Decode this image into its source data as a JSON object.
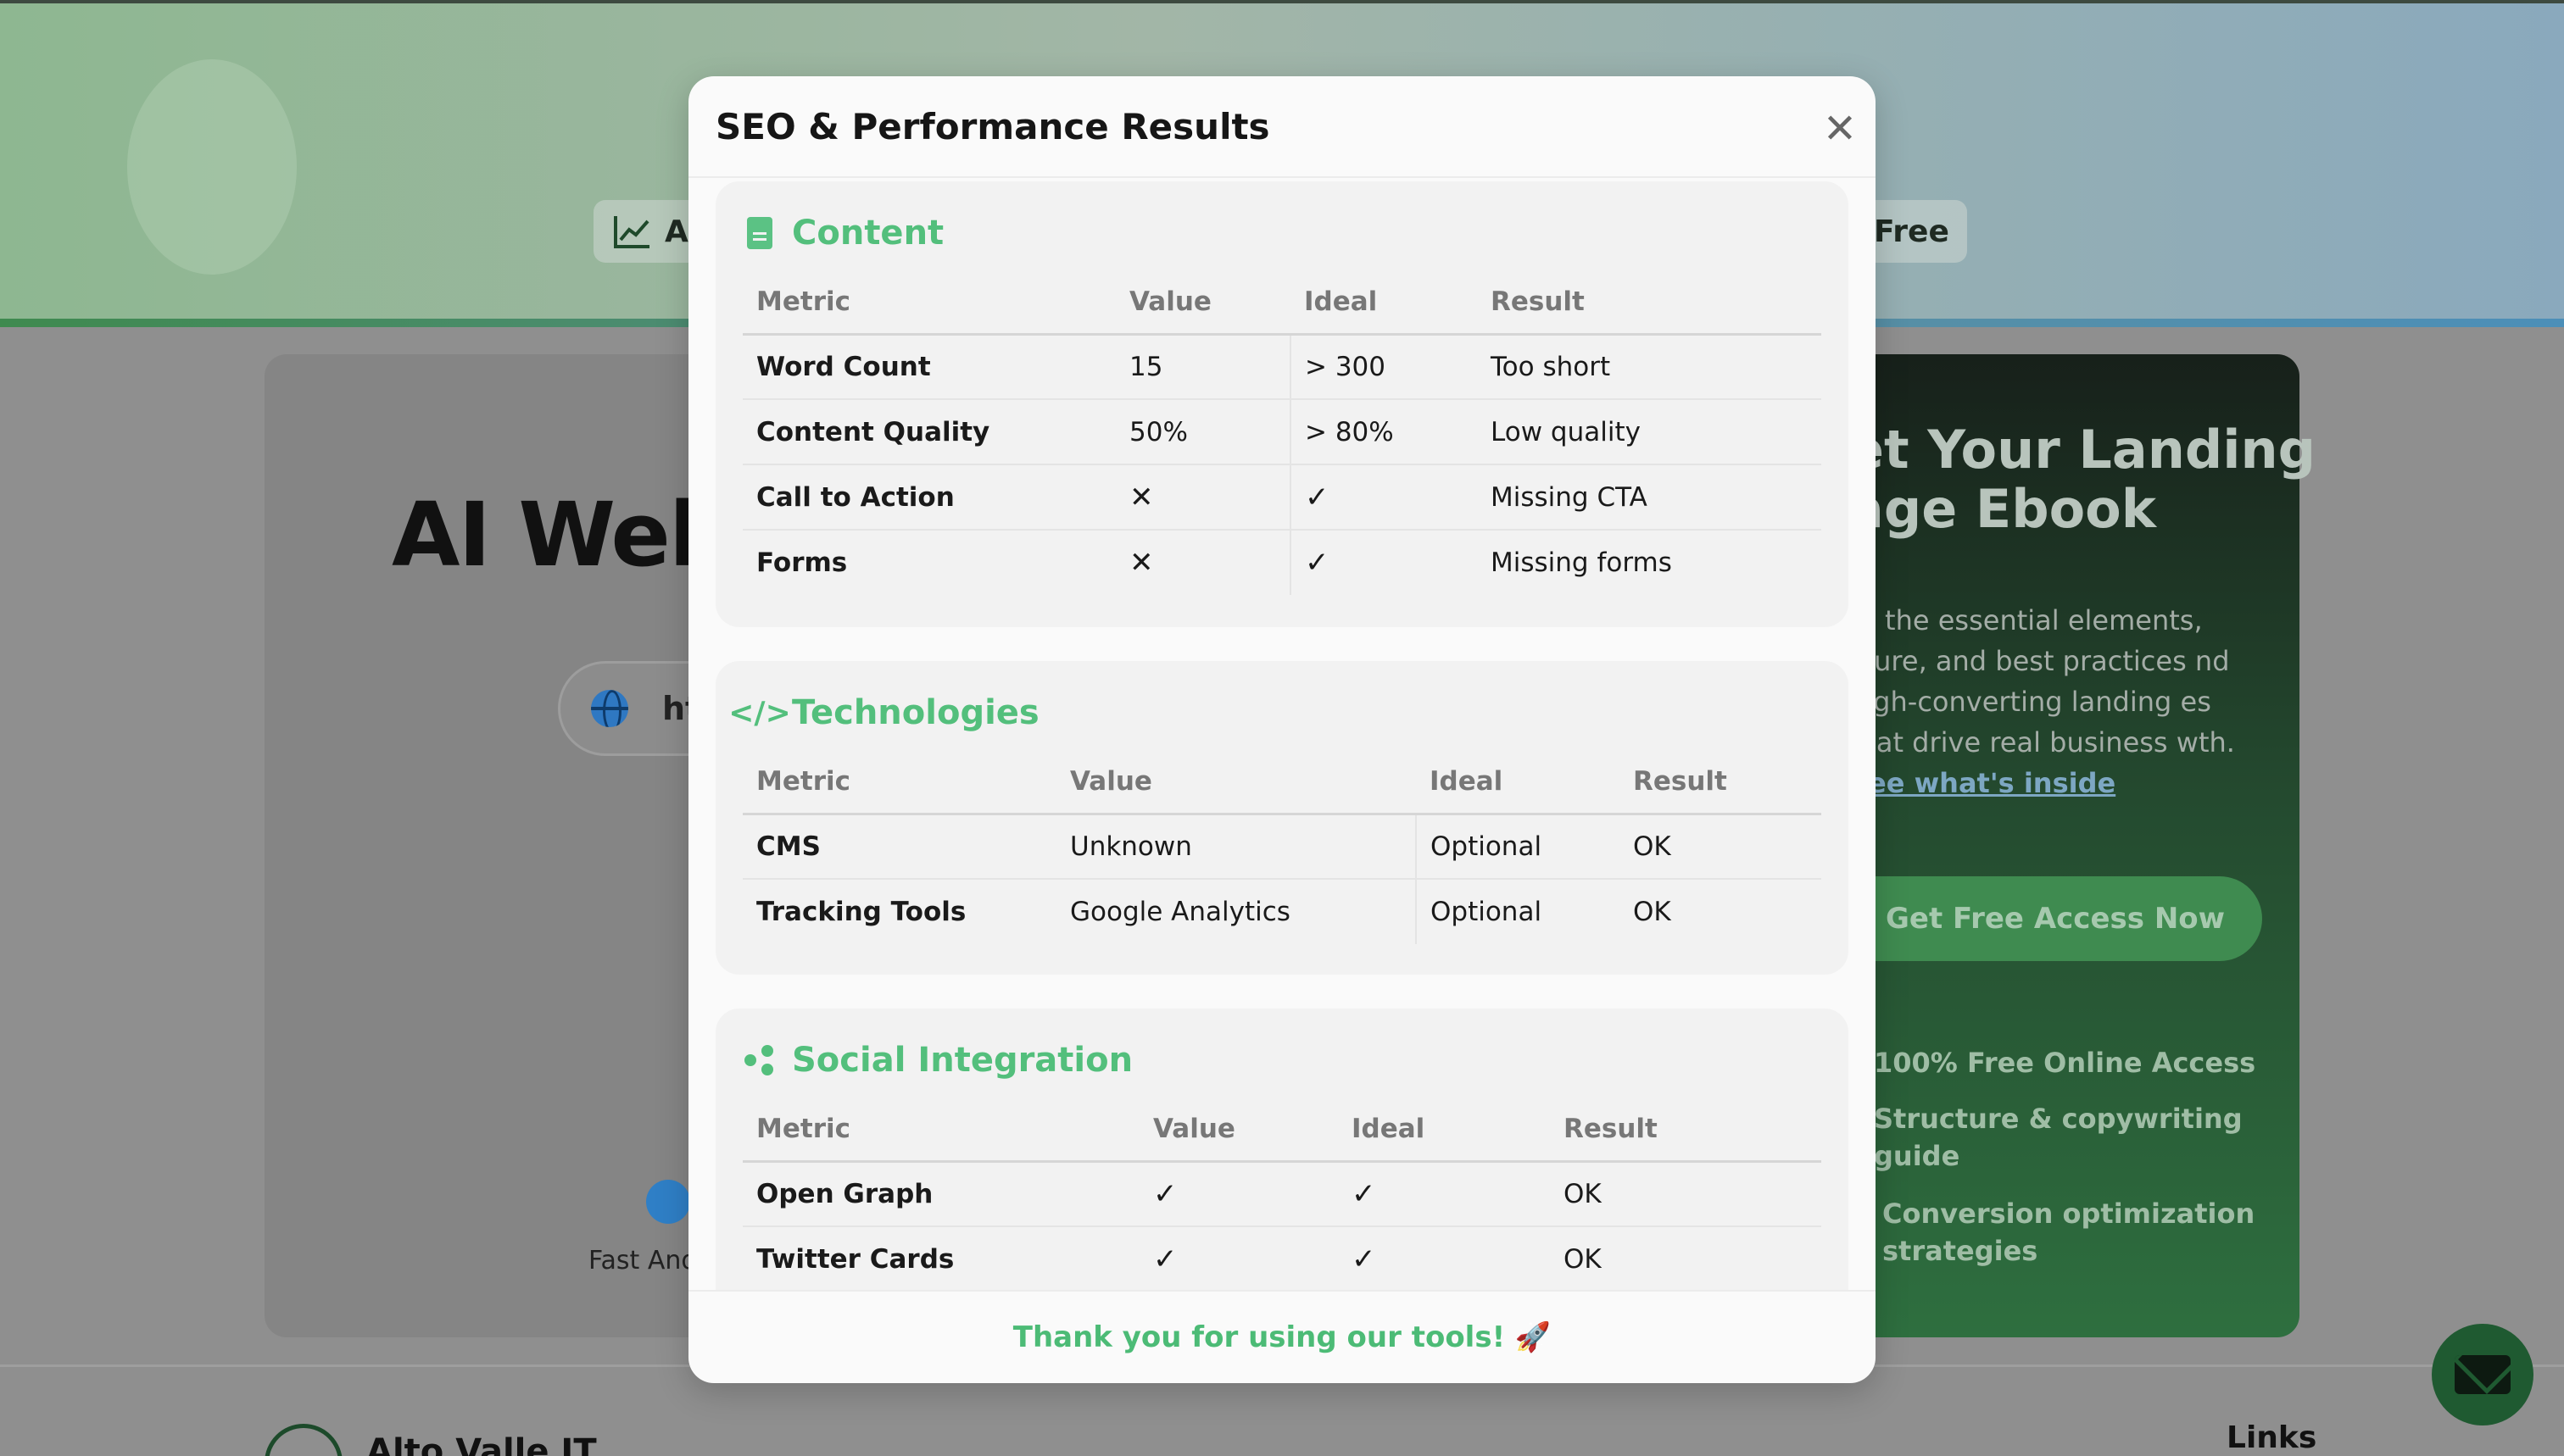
{
  "background": {
    "hero_pill_left": "A",
    "hero_pill_right": "Free",
    "tool_title": "AI Webs",
    "url_partial": "ht",
    "feature_label": "Fast And",
    "ebook": {
      "title": "et Your Landing age Ebook",
      "description": "rn the essential elements, cture, and best practices nd high-converting landing es that drive real business wth.",
      "link": "See what's inside",
      "cta": "Get Free Access Now",
      "features": [
        "100% Free Online Access",
        "Structure & copywriting guide",
        "Conversion optimization strategies"
      ]
    },
    "footer_brand": "Alto Valle IT",
    "footer_links": "Links"
  },
  "modal": {
    "title": "SEO & Performance Results",
    "close_symbol": "✕",
    "footer": "Thank you for using our tools! 🚀",
    "sections": {
      "content": {
        "title": "Content",
        "headers": [
          "Metric",
          "Value",
          "Ideal",
          "Result"
        ],
        "rows": [
          [
            "Word Count",
            "15",
            "> 300",
            "Too short"
          ],
          [
            "Content Quality",
            "50%",
            "> 80%",
            "Low quality"
          ],
          [
            "Call to Action",
            "✕",
            "✓",
            "Missing CTA"
          ],
          [
            "Forms",
            "✕",
            "✓",
            "Missing forms"
          ]
        ]
      },
      "technologies": {
        "title": "Technologies",
        "headers": [
          "Metric",
          "Value",
          "Ideal",
          "Result"
        ],
        "rows": [
          [
            "CMS",
            "Unknown",
            "Optional",
            "OK"
          ],
          [
            "Tracking Tools",
            "Google Analytics",
            "Optional",
            "OK"
          ]
        ]
      },
      "social": {
        "title": "Social Integration",
        "headers": [
          "Metric",
          "Value",
          "Ideal",
          "Result"
        ],
        "rows": [
          [
            "Open Graph",
            "✓",
            "✓",
            "OK"
          ],
          [
            "Twitter Cards",
            "✓",
            "✓",
            "OK"
          ]
        ]
      }
    }
  },
  "colors": {
    "accent_green": "#53bf7c",
    "footer_green": "#4cbb76"
  }
}
